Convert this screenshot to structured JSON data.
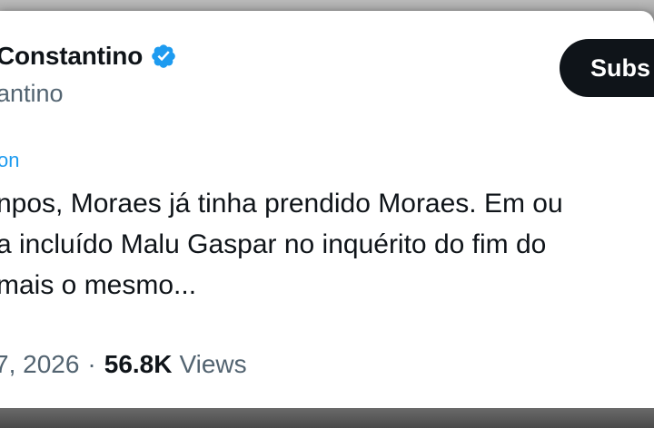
{
  "tweet": {
    "display_name": "Constantino",
    "handle": "antino",
    "subscribe_label": "Subs",
    "translate_label": "on",
    "text_lines": [
      "npos, Moraes já tinha prendido Moraes. Em ou",
      "a incluído Malu Gaspar no inquérito do fim do",
      "mais o mesmo..."
    ],
    "date": "7, 2026",
    "separator": "·",
    "views_count": "56.8K",
    "views_label": "Views"
  },
  "icons": {
    "verified": "verified-badge-icon"
  },
  "colors": {
    "verified_blue": "#1d9bf0",
    "text_primary": "#0f1419",
    "text_secondary": "#536471",
    "link_blue": "#1d9bf0"
  }
}
